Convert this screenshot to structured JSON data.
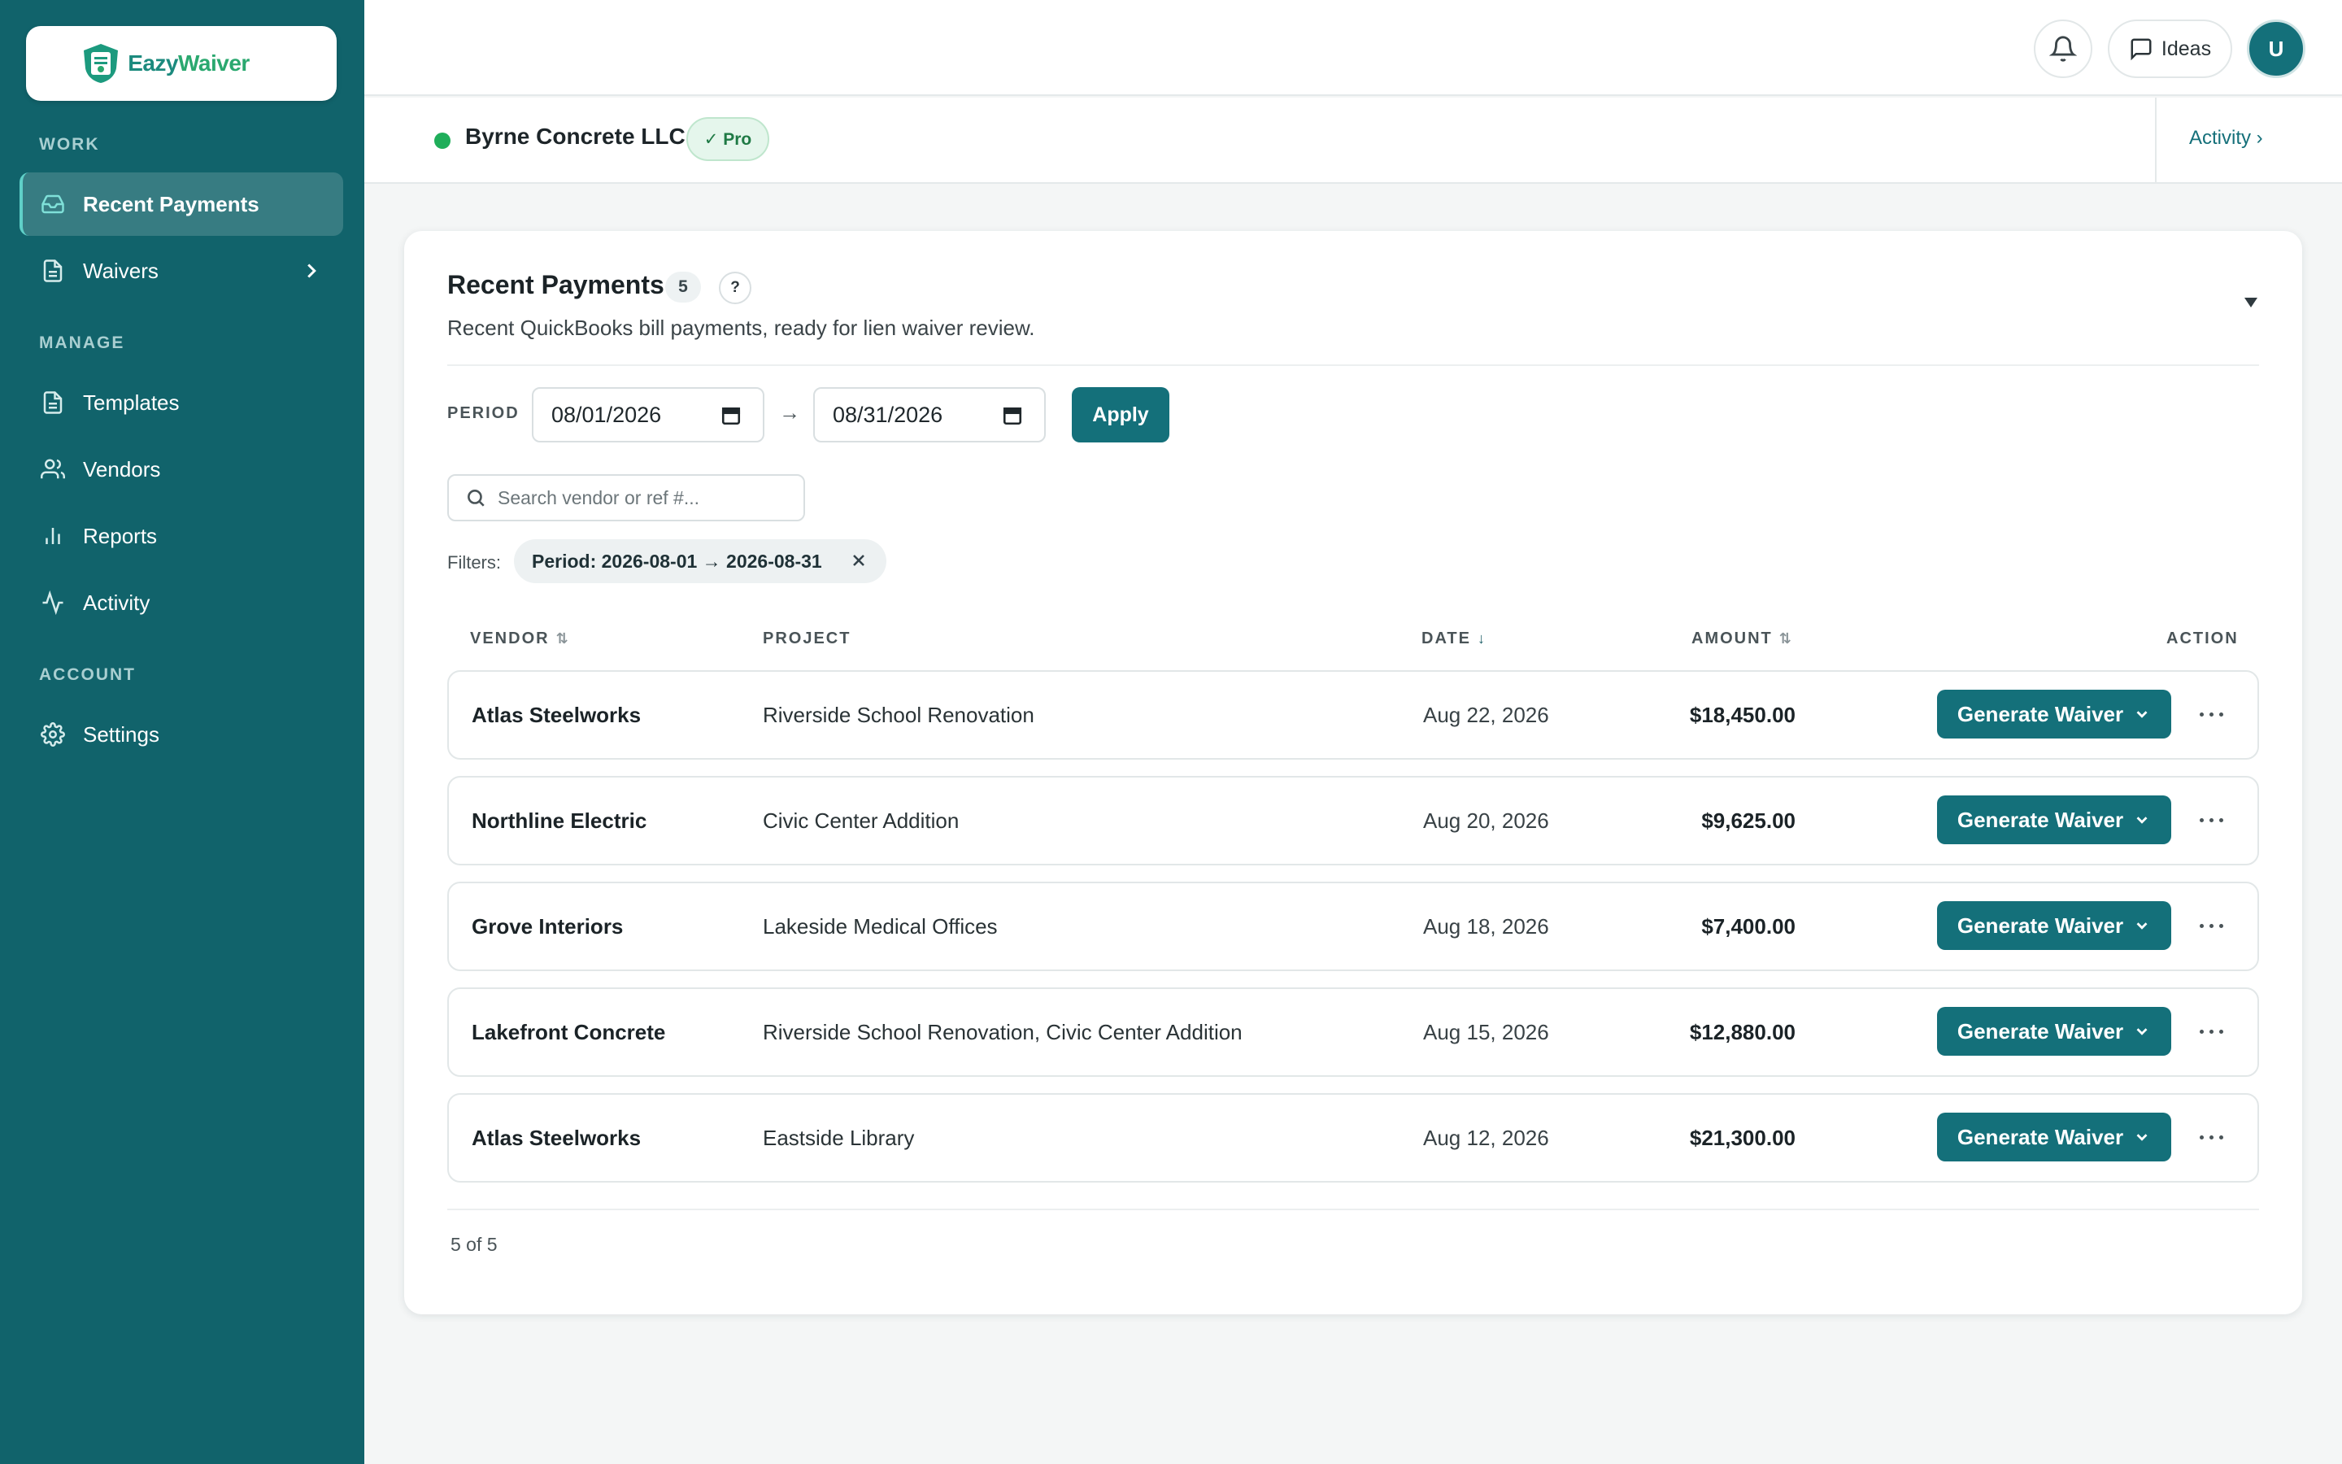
{
  "brand": {
    "name_part1": "Eazy",
    "name_part2": "Waiver",
    "accent": "#14707a"
  },
  "sidebar": {
    "sections": [
      {
        "label": "WORK"
      },
      {
        "label": "MANAGE"
      },
      {
        "label": "ACCOUNT"
      }
    ],
    "items": [
      {
        "label": "Recent Payments",
        "icon": "inbox-icon",
        "active": true
      },
      {
        "label": "Waivers",
        "icon": "document-icon"
      },
      {
        "label": "Templates",
        "icon": "document-icon"
      },
      {
        "label": "Vendors",
        "icon": "users-icon"
      },
      {
        "label": "Reports",
        "icon": "bar-chart-icon"
      },
      {
        "label": "Activity",
        "icon": "activity-icon"
      },
      {
        "label": "Settings",
        "icon": "gear-icon"
      }
    ]
  },
  "topbar": {
    "ideas_label": "Ideas",
    "avatar_initial": "U"
  },
  "company": {
    "name": "Byrne Concrete LLC",
    "plan_badge": "✓ Pro",
    "activity_link": "Activity ›"
  },
  "card": {
    "title": "Recent Payments",
    "count": "5",
    "help": "?",
    "subtitle": "Recent QuickBooks bill payments, ready for lien waiver review."
  },
  "filters": {
    "period_label": "PERIOD",
    "start_date": "08/01/2026",
    "arrow": "→",
    "end_date": "08/31/2026",
    "apply_label": "Apply",
    "search_placeholder": "Search vendor or ref #...",
    "filters_label": "Filters:",
    "active_chip": "Period: 2026-08-01 → 2026-08-31"
  },
  "table": {
    "headers": {
      "vendor": "VENDOR",
      "project": "PROJECT",
      "date": "DATE",
      "amount": "AMOUNT",
      "action": "ACTION"
    },
    "action_label": "Generate Waiver",
    "rows": [
      {
        "vendor": "Atlas Steelworks",
        "project": "Riverside School Renovation",
        "date": "Aug 22, 2026",
        "amount": "$18,450.00"
      },
      {
        "vendor": "Northline Electric",
        "project": "Civic Center Addition",
        "date": "Aug 20, 2026",
        "amount": "$9,625.00"
      },
      {
        "vendor": "Grove Interiors",
        "project": "Lakeside Medical Offices",
        "date": "Aug 18, 2026",
        "amount": "$7,400.00"
      },
      {
        "vendor": "Lakefront Concrete",
        "project": "Riverside School Renovation, Civic Center Addition",
        "date": "Aug 15, 2026",
        "amount": "$12,880.00"
      },
      {
        "vendor": "Atlas Steelworks",
        "project": "Eastside Library",
        "date": "Aug 12, 2026",
        "amount": "$21,300.00"
      }
    ],
    "footer": "5 of 5"
  }
}
